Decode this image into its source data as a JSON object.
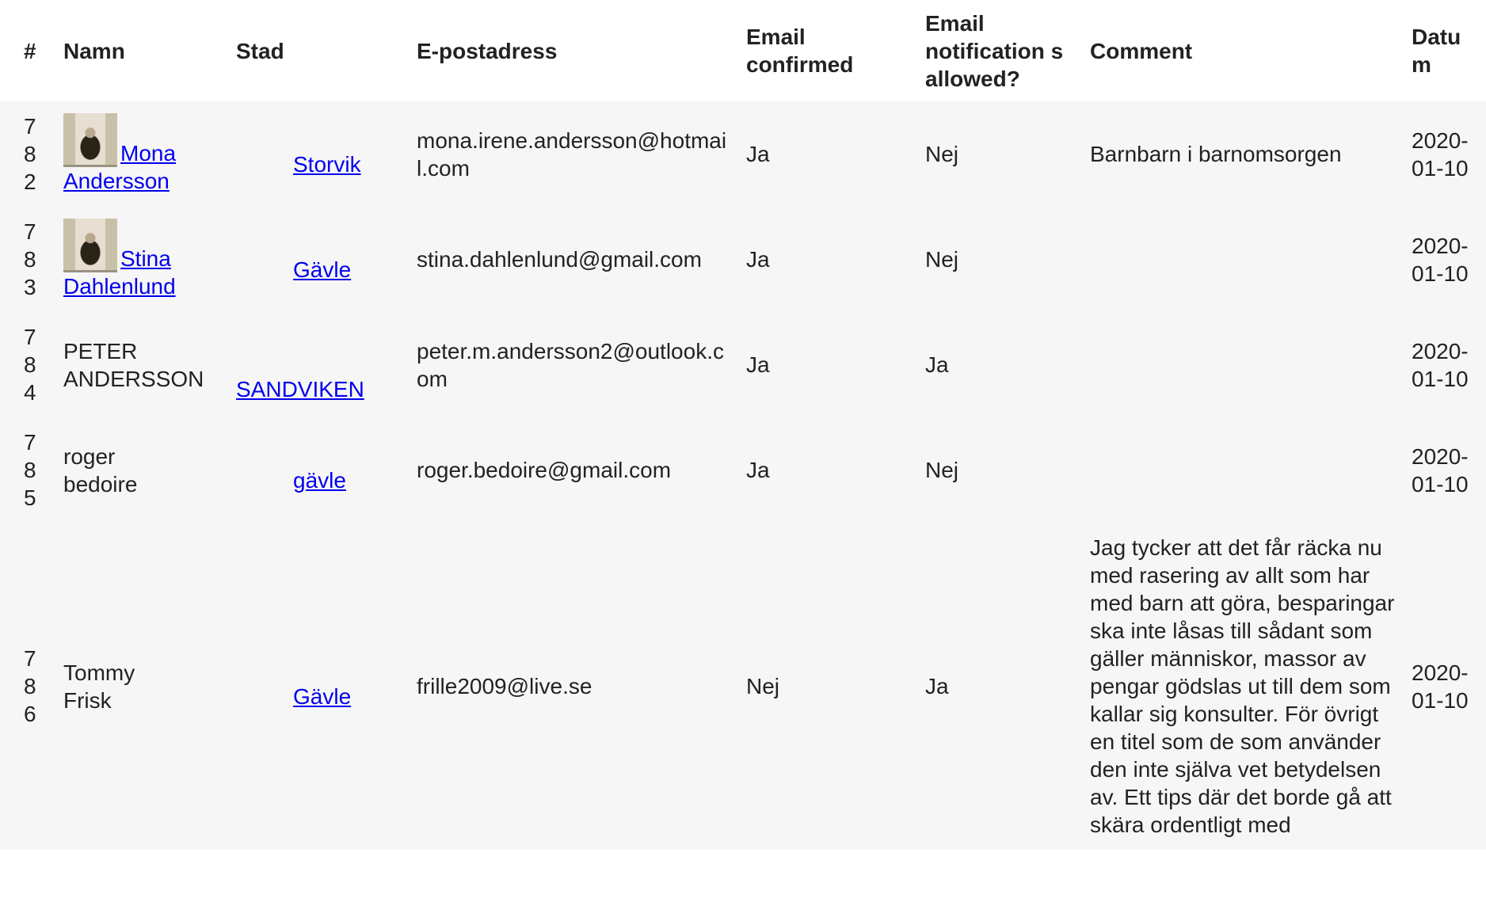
{
  "table": {
    "headers": {
      "num": "#",
      "name": "Namn",
      "city": "Stad",
      "email": "E-postadress",
      "email_confirmed": "Email confirmed",
      "notifications": "Email notification s allowed?",
      "comment": "Comment",
      "date": "Datu m"
    },
    "rows": [
      {
        "num": "782",
        "first_name": "Mona",
        "last_name": "Andersson",
        "name_is_link": true,
        "has_avatar": true,
        "city": "Storvik",
        "email": "mona.irene.andersson@hotmail.com",
        "email_confirmed": "Ja",
        "notifications": "Nej",
        "comment": "Barnbarn i barnomsorgen",
        "date": "2020-01-10"
      },
      {
        "num": "783",
        "first_name": "Stina",
        "last_name": "Dahlenlund",
        "name_is_link": true,
        "has_avatar": true,
        "city": "Gävle",
        "email": "stina.dahlenlund@gmail.com",
        "email_confirmed": "Ja",
        "notifications": "Nej",
        "comment": "",
        "date": "2020-01-10"
      },
      {
        "num": "784",
        "first_name": "PETER",
        "last_name": "ANDERSSON",
        "name_is_link": false,
        "has_avatar": false,
        "city": "SANDVIKEN",
        "email": "peter.m.andersson2@outlook.com",
        "email_confirmed": "Ja",
        "notifications": "Ja",
        "comment": "",
        "date": "2020-01-10"
      },
      {
        "num": "785",
        "first_name": "roger",
        "last_name": "bedoire",
        "name_is_link": false,
        "has_avatar": false,
        "city": "gävle",
        "email": "roger.bedoire@gmail.com",
        "email_confirmed": "Ja",
        "notifications": "Nej",
        "comment": "",
        "date": "2020-01-10"
      },
      {
        "num": "786",
        "first_name": "Tommy",
        "last_name": "Frisk",
        "name_is_link": false,
        "has_avatar": false,
        "city": "Gävle",
        "email": "frille2009@live.se",
        "email_confirmed": "Nej",
        "notifications": "Ja",
        "comment": "Jag tycker att det får räcka nu med rasering av allt som har med barn att göra, besparingar ska inte låsas till sådant som gäller människor, massor av pengar gödslas ut till dem som kallar sig konsulter. För övrigt en titel som de som använder den inte själva vet betydelsen av. Ett tips där det borde gå att skära ordentligt med",
        "date": "2020-01-10"
      }
    ]
  }
}
